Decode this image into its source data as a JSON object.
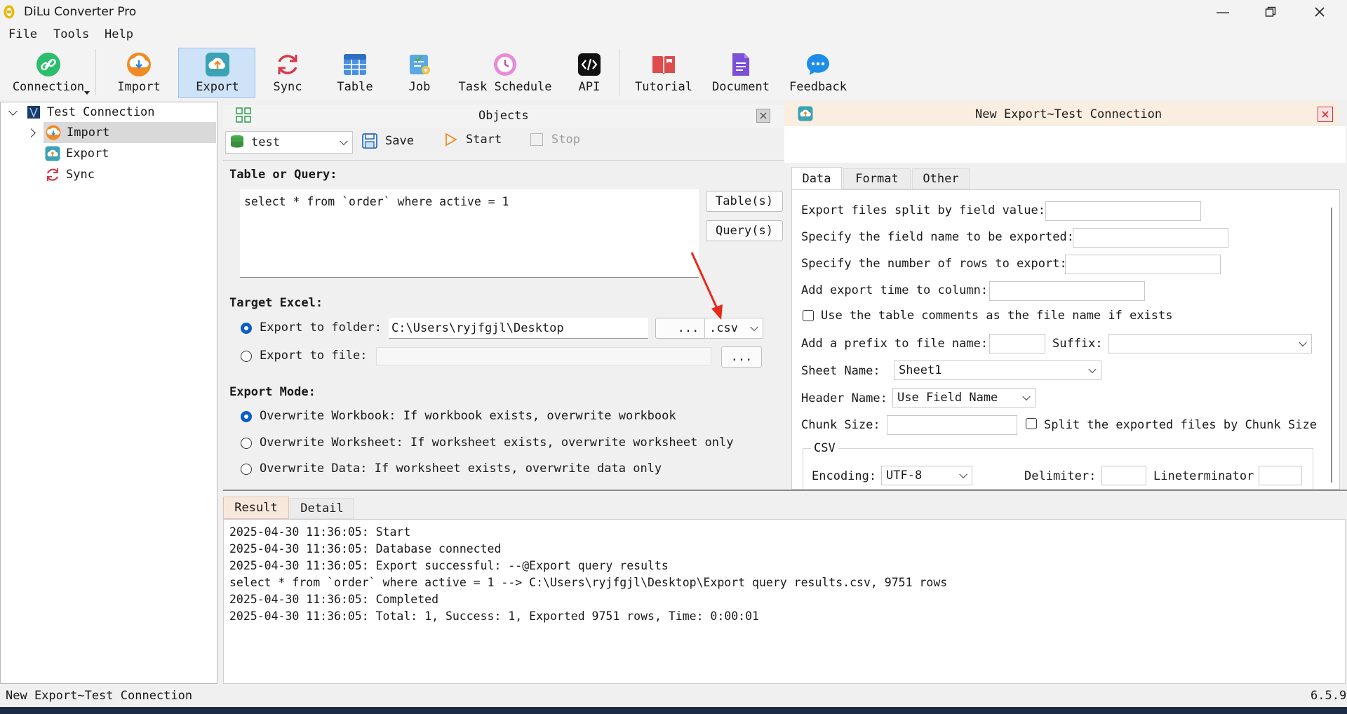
{
  "app": {
    "title": "DiLu Converter Pro"
  },
  "menu": [
    "File",
    "Tools",
    "Help"
  ],
  "toolbar": [
    {
      "label": "Connection",
      "icon": "link-icon"
    },
    {
      "label": "Import",
      "icon": "import-icon"
    },
    {
      "label": "Export",
      "icon": "export-icon"
    },
    {
      "label": "Sync",
      "icon": "sync-icon"
    },
    {
      "label": "Table",
      "icon": "table-icon"
    },
    {
      "label": "Job",
      "icon": "job-icon"
    },
    {
      "label": "Task Schedule",
      "icon": "clock-icon"
    },
    {
      "label": "API",
      "icon": "api-icon"
    },
    {
      "label": "Tutorial",
      "icon": "book-icon"
    },
    {
      "label": "Document",
      "icon": "document-icon"
    },
    {
      "label": "Feedback",
      "icon": "chat-icon"
    }
  ],
  "tree": {
    "root": "Test Connection",
    "items": [
      "Import",
      "Export",
      "Sync"
    ]
  },
  "objects": {
    "title": "Objects",
    "database": "test",
    "save_label": "Save",
    "start_label": "Start",
    "stop_label": "Stop"
  },
  "query": {
    "label": "Table or Query:",
    "text": "select * from `order` where active = 1",
    "tables_btn": "Table(s)",
    "queries_btn": "Query(s)"
  },
  "target": {
    "label": "Target Excel:",
    "folder_label": "Export to folder:",
    "folder_value": "C:\\Users\\ryjfgjl\\Desktop",
    "browse": "...",
    "ext": ".csv",
    "file_label": "Export to file:"
  },
  "mode": {
    "label": "Export Mode:",
    "options": [
      "Overwrite Workbook: If workbook exists, overwrite workbook",
      "Overwrite Worksheet: If worksheet exists, overwrite worksheet only",
      "Overwrite Data: If worksheet exists, overwrite data only"
    ]
  },
  "export_panel": {
    "title": "New Export~Test Connection",
    "tabs": [
      "Data",
      "Format",
      "Other"
    ],
    "split_by_field": "Export files split by field value:",
    "field_name": "Specify the field name to be exported:",
    "rows": "Specify the number of rows to export:",
    "add_time": "Add export time to column:",
    "use_comments": "Use the table comments as the file name if exists",
    "prefix": "Add a prefix to file name:",
    "suffix": "Suffix:",
    "sheet_name_label": "Sheet Name:",
    "sheet_name_value": "Sheet1",
    "header_name_label": "Header Name:",
    "header_name_value": "Use Field Name",
    "chunk_label": "Chunk Size:",
    "chunk_split": "Split the exported files by Chunk Size",
    "csv_group": "CSV",
    "encoding_label": "Encoding:",
    "encoding_value": "UTF-8",
    "delimiter_label": "Delimiter:",
    "lineterminator_label": "Lineterminator"
  },
  "result": {
    "tabs": [
      "Result",
      "Detail"
    ],
    "lines": [
      "2025-04-30 11:36:05: Start",
      "2025-04-30 11:36:05: Database connected",
      "2025-04-30 11:36:05: Export successful: --@Export query results",
      "select * from `order` where active = 1 --> C:\\Users\\ryjfgjl\\Desktop\\Export query results.csv, 9751 rows",
      "2025-04-30 11:36:05: Completed",
      "2025-04-30 11:36:05: Total: 1, Success: 1, Exported 9751 rows, Time: 0:00:01"
    ]
  },
  "status": {
    "left": "New Export~Test Connection",
    "version": "6.5.9"
  },
  "colors": {
    "accent": "#0a5fc4",
    "export_header": "#faeee0",
    "arrow": "#e8291c"
  }
}
